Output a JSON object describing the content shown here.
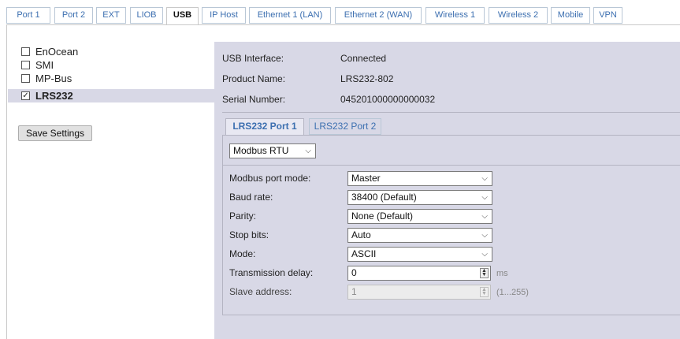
{
  "top_tabs": [
    "Port 1",
    "Port 2",
    "EXT",
    "LIOB",
    "USB",
    "IP Host",
    "Ethernet 1 (LAN)",
    "Ethernet 2 (WAN)",
    "Wireless 1",
    "Wireless 2",
    "Mobile",
    "VPN"
  ],
  "active_top_tab": "USB",
  "devices": [
    {
      "label": "EnOcean",
      "checked": false
    },
    {
      "label": "SMI",
      "checked": false
    },
    {
      "label": "MP-Bus",
      "checked": false
    },
    {
      "label": "LRS232",
      "checked": true
    }
  ],
  "save_button": "Save Settings",
  "info": {
    "usb_interface_label": "USB Interface:",
    "usb_interface_value": "Connected",
    "product_name_label": "Product Name:",
    "product_name_value": "LRS232-802",
    "serial_number_label": "Serial Number:",
    "serial_number_value": "045201000000000032"
  },
  "sub_tabs": [
    "LRS232 Port 1",
    "LRS232 Port 2"
  ],
  "protocol": "Modbus RTU",
  "form": {
    "modbus_port_mode": {
      "label": "Modbus port mode:",
      "value": "Master"
    },
    "baud_rate": {
      "label": "Baud rate:",
      "value": "38400 (Default)"
    },
    "parity": {
      "label": "Parity:",
      "value": "None (Default)"
    },
    "stop_bits": {
      "label": "Stop bits:",
      "value": "Auto"
    },
    "mode": {
      "label": "Mode:",
      "value": "ASCII"
    },
    "transmission_delay": {
      "label": "Transmission delay:",
      "value": "0",
      "unit": "ms"
    },
    "slave_address": {
      "label": "Slave address:",
      "value": "1",
      "range": "(1...255)"
    }
  },
  "icons": {
    "chevron": "chevron-down-icon",
    "checkmark": "checkmark-icon",
    "spinner": "spin-arrows-icon"
  },
  "colors": {
    "panel": "#d8d8e6",
    "tab_link": "#3c6fb0",
    "border": "#b9c7d6"
  }
}
